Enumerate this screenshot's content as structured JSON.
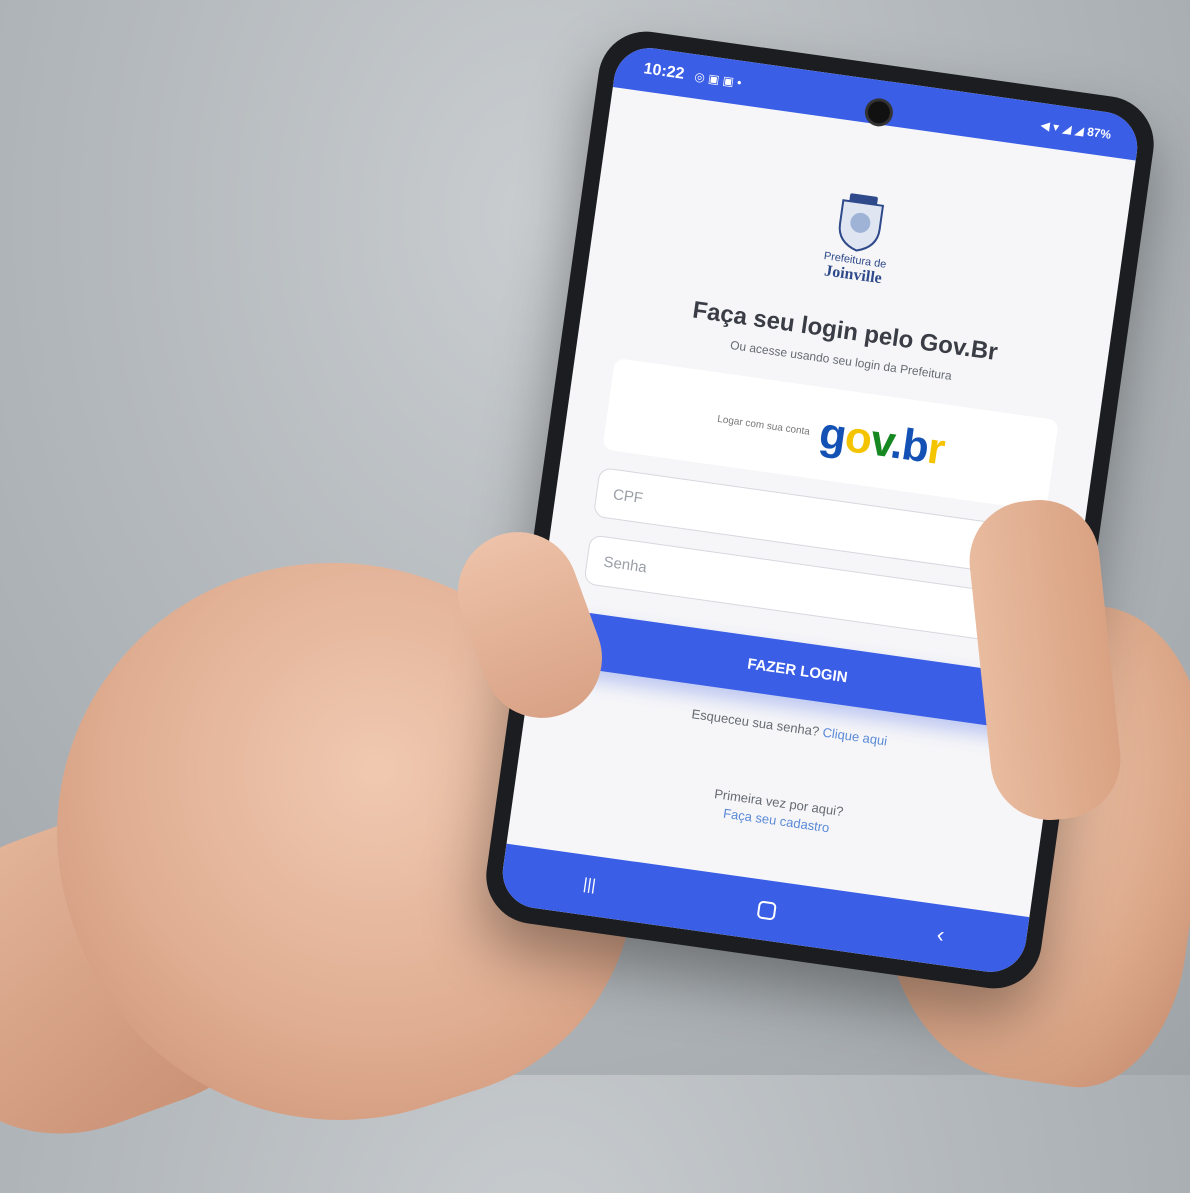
{
  "status_bar": {
    "time": "10:22",
    "notif_icons": "◎ ▣ ▣ •",
    "right_status": "◀ ▾ ◢ ◢ 87%"
  },
  "logo": {
    "line1": "Prefeitura de",
    "line2": "Joinville"
  },
  "login": {
    "title": "Faça seu login pelo Gov.Br",
    "subtitle": "Ou acesse usando seu login da Prefeitura",
    "govbr_label": "Logar com sua conta",
    "govbr_g": "g",
    "govbr_o": "o",
    "govbr_v": "v",
    "govbr_dot": ".",
    "govbr_b": "b",
    "govbr_r": "r",
    "cpf_placeholder": "CPF",
    "password_placeholder": "Senha",
    "button_label": "FAZER LOGIN",
    "forgot_text": "Esqueceu sua senha?",
    "forgot_link": "Clique aqui",
    "first_time_text": "Primeira vez por aqui?",
    "register_link": "Faça seu cadastro"
  },
  "nav": {
    "recents": "|||",
    "back": "‹"
  },
  "colors": {
    "accent": "#3a5ee6",
    "govbr_blue": "#1351b4",
    "govbr_yellow": "#f5c400",
    "govbr_green": "#168821",
    "link": "#5b8ad8"
  }
}
